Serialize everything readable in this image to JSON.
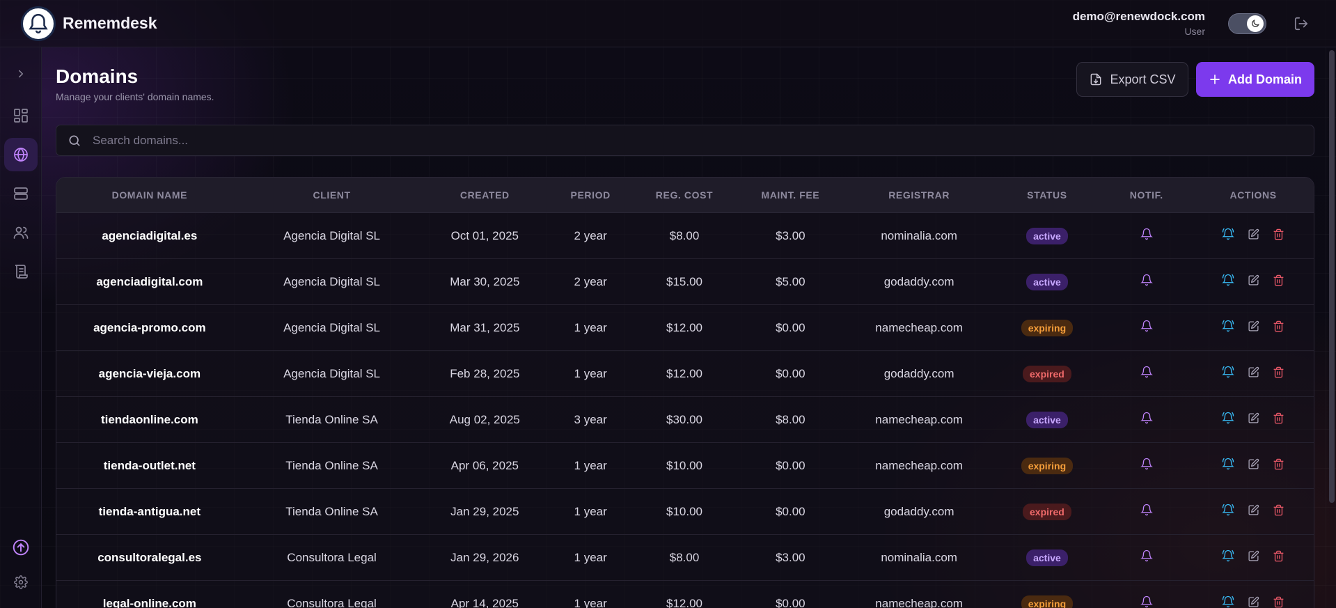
{
  "app": {
    "name": "Rememdesk"
  },
  "user": {
    "email": "demo@renewdock.com",
    "role": "User"
  },
  "page": {
    "title": "Domains",
    "subtitle": "Manage your clients' domain names."
  },
  "buttons": {
    "export": "Export CSV",
    "add": "Add Domain"
  },
  "search": {
    "placeholder": "Search domains..."
  },
  "table": {
    "columns": [
      "DOMAIN NAME",
      "CLIENT",
      "CREATED",
      "PERIOD",
      "REG. COST",
      "MAINT. FEE",
      "REGISTRAR",
      "STATUS",
      "NOTIF.",
      "ACTIONS"
    ],
    "rows": [
      {
        "domain": "agenciadigital.es",
        "client": "Agencia Digital SL",
        "created": "Oct 01, 2025",
        "period": "2 year",
        "reg_cost": "$8.00",
        "maint_fee": "$3.00",
        "registrar": "nominalia.com",
        "status": "active"
      },
      {
        "domain": "agenciadigital.com",
        "client": "Agencia Digital SL",
        "created": "Mar 30, 2025",
        "period": "2 year",
        "reg_cost": "$15.00",
        "maint_fee": "$5.00",
        "registrar": "godaddy.com",
        "status": "active"
      },
      {
        "domain": "agencia-promo.com",
        "client": "Agencia Digital SL",
        "created": "Mar 31, 2025",
        "period": "1 year",
        "reg_cost": "$12.00",
        "maint_fee": "$0.00",
        "registrar": "namecheap.com",
        "status": "expiring"
      },
      {
        "domain": "agencia-vieja.com",
        "client": "Agencia Digital SL",
        "created": "Feb 28, 2025",
        "period": "1 year",
        "reg_cost": "$12.00",
        "maint_fee": "$0.00",
        "registrar": "godaddy.com",
        "status": "expired"
      },
      {
        "domain": "tiendaonline.com",
        "client": "Tienda Online SA",
        "created": "Aug 02, 2025",
        "period": "3 year",
        "reg_cost": "$30.00",
        "maint_fee": "$8.00",
        "registrar": "namecheap.com",
        "status": "active"
      },
      {
        "domain": "tienda-outlet.net",
        "client": "Tienda Online SA",
        "created": "Apr 06, 2025",
        "period": "1 year",
        "reg_cost": "$10.00",
        "maint_fee": "$0.00",
        "registrar": "namecheap.com",
        "status": "expiring"
      },
      {
        "domain": "tienda-antigua.net",
        "client": "Tienda Online SA",
        "created": "Jan 29, 2025",
        "period": "1 year",
        "reg_cost": "$10.00",
        "maint_fee": "$0.00",
        "registrar": "godaddy.com",
        "status": "expired"
      },
      {
        "domain": "consultoralegal.es",
        "client": "Consultora Legal",
        "created": "Jan 29, 2026",
        "period": "1 year",
        "reg_cost": "$8.00",
        "maint_fee": "$3.00",
        "registrar": "nominalia.com",
        "status": "active"
      },
      {
        "domain": "legal-online.com",
        "client": "Consultora Legal",
        "created": "Apr 14, 2025",
        "period": "1 year",
        "reg_cost": "$12.00",
        "maint_fee": "$0.00",
        "registrar": "namecheap.com",
        "status": "expiring"
      }
    ]
  },
  "sidebar": {
    "items": [
      {
        "icon": "chevron-right-icon"
      },
      {
        "icon": "dashboard-icon"
      },
      {
        "icon": "globe-icon",
        "active": true
      },
      {
        "icon": "server-icon"
      },
      {
        "icon": "users-icon"
      },
      {
        "icon": "scroll-icon"
      },
      {
        "icon": "upload-icon"
      },
      {
        "icon": "gear-icon"
      }
    ]
  },
  "colors": {
    "accent": "#7c3aed",
    "active": "#c8a8ff",
    "expiring": "#f59e3a",
    "expired": "#f06a6a",
    "notify": "#c084fc",
    "action_bell": "#38bdf8",
    "action_delete": "#f05a6a"
  }
}
